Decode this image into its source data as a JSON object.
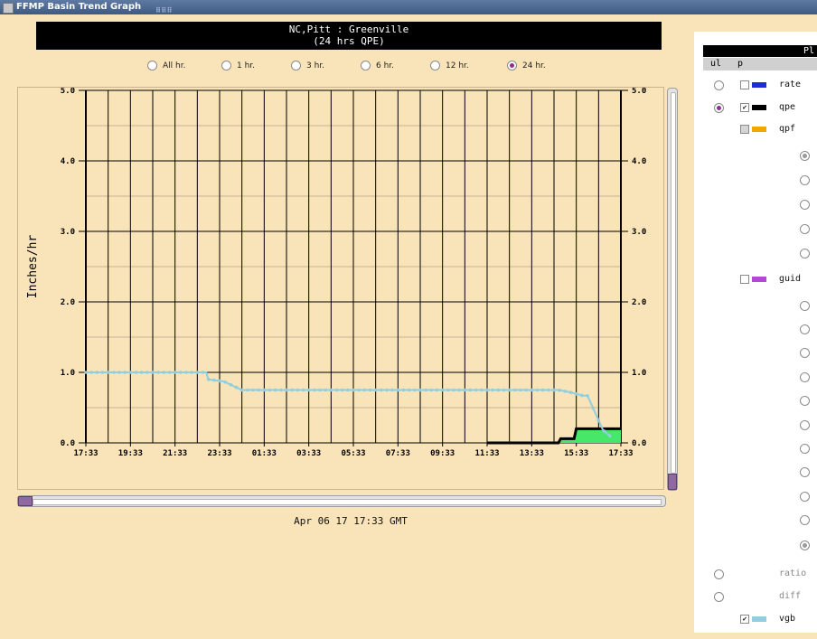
{
  "window": {
    "title": "FFMP Basin Trend Graph"
  },
  "graph": {
    "title_line1": "NC,Pitt : Greenville",
    "title_line2": "(24 hrs QPE)",
    "ylabel": "Inches/hr",
    "date": "Apr 06 17 17:33 GMT"
  },
  "time_options": [
    {
      "label": "All hr.",
      "selected": false
    },
    {
      "label": "1 hr.",
      "selected": false
    },
    {
      "label": "3 hr.",
      "selected": false
    },
    {
      "label": "6 hr.",
      "selected": false
    },
    {
      "label": "12 hr.",
      "selected": false
    },
    {
      "label": "24 hr.",
      "selected": true
    }
  ],
  "chart_data": {
    "type": "line",
    "ylabel": "Inches/hr",
    "ylim": [
      0,
      5
    ],
    "y_ticks": [
      "0.0",
      "1.0",
      "2.0",
      "3.0",
      "4.0",
      "5.0"
    ],
    "x_ticks": [
      "17:33",
      "19:33",
      "21:33",
      "23:33",
      "01:33",
      "03:33",
      "05:33",
      "07:33",
      "09:33",
      "11:33",
      "13:33",
      "15:33",
      "17:33"
    ],
    "xlim_hours": [
      0,
      24
    ],
    "grid": true,
    "series": [
      {
        "name": "vgb",
        "color": "#8fcfe0",
        "x": [
          0,
          5.4,
          5.5,
          6.2,
          6.8,
          7.0,
          21.2,
          21.7,
          22.3,
          22.5,
          23.2,
          23.5
        ],
        "y": [
          1.0,
          1.0,
          0.9,
          0.87,
          0.78,
          0.75,
          0.75,
          0.72,
          0.67,
          0.67,
          0.18,
          0.1
        ]
      },
      {
        "name": "qpe",
        "color": "#000000",
        "x": [
          18.0,
          21.2,
          21.3,
          21.9,
          22.0,
          24.0
        ],
        "y": [
          0.0,
          0.0,
          0.06,
          0.06,
          0.2,
          0.2
        ]
      }
    ]
  },
  "panel": {
    "header": "Pl",
    "col_ul": "ul",
    "col_p": "p",
    "rows": [
      {
        "label": "rate",
        "swatch": "#1f2bd8",
        "ul": "empty",
        "check": "empty"
      },
      {
        "label": "qpe",
        "swatch": "#000000",
        "ul": "on",
        "check": "checked"
      },
      {
        "label": "qpf",
        "swatch": "#f0a800",
        "ul": "none",
        "check": "grey"
      },
      {
        "label": "guid",
        "swatch": "#b24ad6",
        "ul": "none",
        "check": "empty"
      },
      {
        "label": "ratio",
        "ul": "grey-empty",
        "check": "none"
      },
      {
        "label": "diff",
        "ul": "grey-empty",
        "check": "none"
      },
      {
        "label": "vgb",
        "swatch": "#8fcfe0",
        "ul": "none",
        "check": "checked"
      }
    ],
    "qpf_sub_selected": 0,
    "guid_sub_selected": 10
  }
}
